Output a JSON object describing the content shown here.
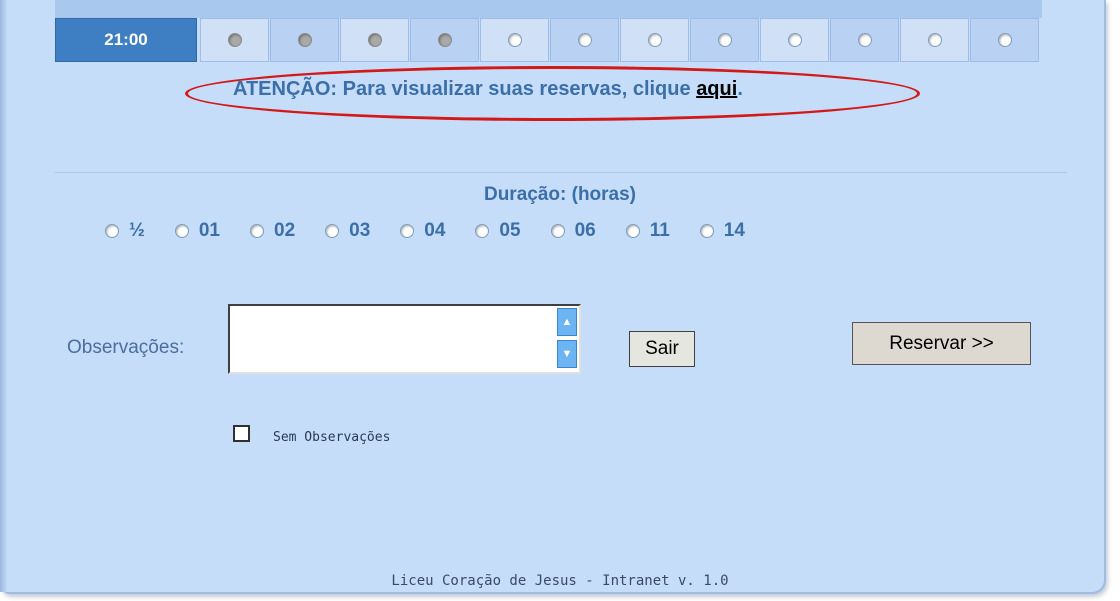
{
  "schedule": {
    "time": "21:00",
    "slots": [
      {
        "state": "disabled"
      },
      {
        "state": "disabled"
      },
      {
        "state": "disabled"
      },
      {
        "state": "disabled"
      },
      {
        "state": "enabled"
      },
      {
        "state": "enabled"
      },
      {
        "state": "enabled"
      },
      {
        "state": "enabled"
      },
      {
        "state": "enabled"
      },
      {
        "state": "enabled"
      },
      {
        "state": "enabled"
      },
      {
        "state": "enabled"
      }
    ]
  },
  "notice": {
    "text": "ATENÇÃO: Para visualizar suas reservas, clique ",
    "link": "aqui",
    "suffix": "."
  },
  "duration": {
    "title": "Duração: (horas)",
    "options": [
      "½",
      "01",
      "02",
      "03",
      "04",
      "05",
      "06",
      "11",
      "14"
    ]
  },
  "form": {
    "observations_label": "Observações:",
    "observations_value": "",
    "exit_label": "Sair",
    "reserve_label": "Reservar >>",
    "no_observations_label": "Sem Observações"
  },
  "footer": "Liceu Coração de Jesus - Intranet v. 1.0",
  "colors": {
    "accent": "#3e7fc3",
    "panel": "#c5ddf8",
    "highlight": "#d41818"
  }
}
